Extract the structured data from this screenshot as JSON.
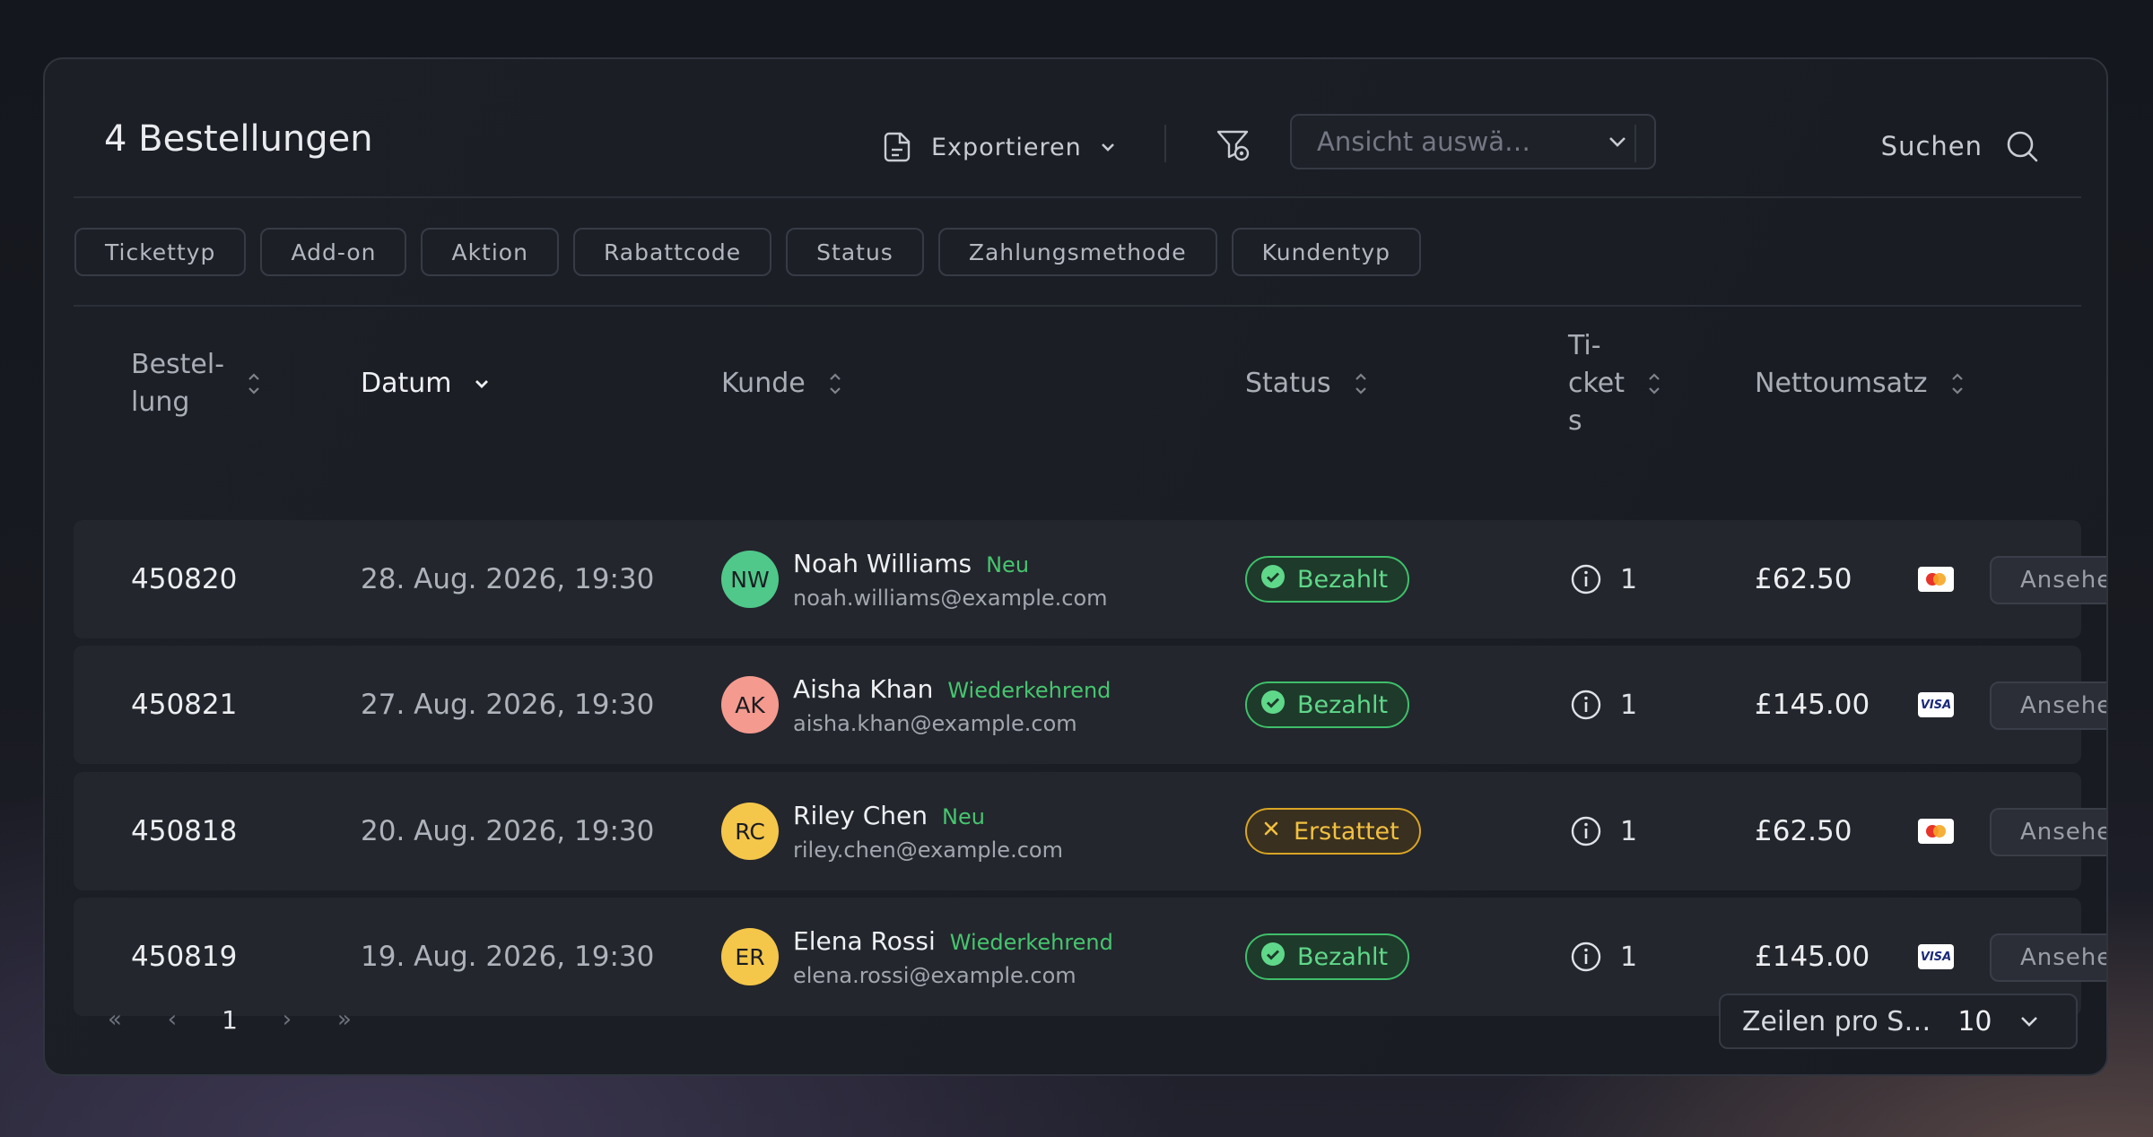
{
  "header": {
    "title": "4 Bestellungen",
    "export_label": "Exportieren",
    "view_placeholder": "Ansicht auswä…",
    "search_label": "Suchen"
  },
  "filters": [
    "Tickettyp",
    "Add-on",
    "Aktion",
    "Rabattcode",
    "Status",
    "Zahlungsmethode",
    "Kundentyp"
  ],
  "columns": {
    "order": "Bestel-\nlung",
    "date": "Datum",
    "customer": "Kunde",
    "status": "Status",
    "tickets": "Ti-\ncket\ns",
    "net": "Nettoumsatz"
  },
  "rows": [
    {
      "order": "450820",
      "date": "28. Aug. 2026, 19:30",
      "initials": "NW",
      "avatar_color": "#4fc88a",
      "name": "Noah Williams",
      "tag": "Neu",
      "email": "noah.williams@example.com",
      "status": "Bezahlt",
      "status_kind": "paid",
      "tickets": "1",
      "net": "£62.50",
      "card": "mastercard",
      "view": "Ansehen"
    },
    {
      "order": "450821",
      "date": "27. Aug. 2026, 19:30",
      "initials": "AK",
      "avatar_color": "#f59a8e",
      "name": "Aisha Khan",
      "tag": "Wiederkehrend",
      "email": "aisha.khan@example.com",
      "status": "Bezahlt",
      "status_kind": "paid",
      "tickets": "1",
      "net": "£145.00",
      "card": "visa",
      "view": "Ansehen"
    },
    {
      "order": "450818",
      "date": "20. Aug. 2026, 19:30",
      "initials": "RC",
      "avatar_color": "#f4c64a",
      "name": "Riley Chen",
      "tag": "Neu",
      "email": "riley.chen@example.com",
      "status": "Erstattet",
      "status_kind": "refund",
      "tickets": "1",
      "net": "£62.50",
      "card": "mastercard",
      "view": "Ansehen"
    },
    {
      "order": "450819",
      "date": "19. Aug. 2026, 19:30",
      "initials": "ER",
      "avatar_color": "#f4c64a",
      "name": "Elena Rossi",
      "tag": "Wiederkehrend",
      "email": "elena.rossi@example.com",
      "status": "Bezahlt",
      "status_kind": "paid",
      "tickets": "1",
      "net": "£145.00",
      "card": "visa",
      "view": "Ansehen"
    }
  ],
  "pagination": {
    "first": "«",
    "prev": "‹",
    "page": "1",
    "next": "›",
    "last": "»",
    "rows_label": "Zeilen pro S…",
    "rows_value": "10"
  },
  "colors": {
    "paid": "#5fd88a",
    "refund": "#f1c040",
    "tag": "#46c56e"
  },
  "icons": {
    "export": "document-export-icon",
    "filter": "filter-settings-icon",
    "search": "search-icon",
    "sort": "sort-icon",
    "info": "info-icon"
  },
  "visa_text": "VISA"
}
